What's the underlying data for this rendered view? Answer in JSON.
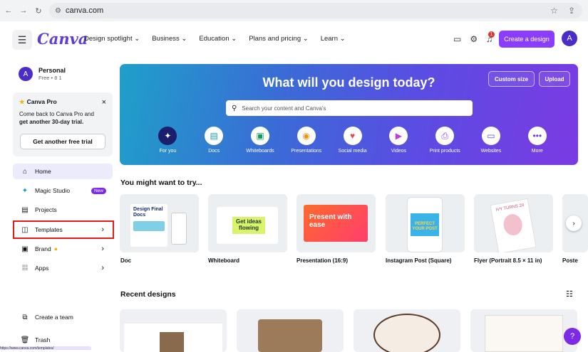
{
  "browser": {
    "url": "canva.com"
  },
  "nav": {
    "logo": "Canva",
    "menu": [
      "Design spotlight ⌄",
      "Business ⌄",
      "Education ⌄",
      "Plans and pricing ⌄",
      "Learn ⌄"
    ],
    "notif_count": "1",
    "create_label": "Create a design",
    "avatar_letter": "A"
  },
  "sidebar": {
    "account_name": "Personal",
    "account_sub": "Free • 8 1",
    "avatar_letter": "A",
    "promo_title": "Canva Pro",
    "promo_body_1": "Come back to Canva Pro and",
    "promo_body_2": "get another 30-day trial.",
    "promo_button": "Get another free trial",
    "items": [
      {
        "label": "Home",
        "icon": "home-icon"
      },
      {
        "label": "Magic Studio",
        "icon": "sparkle-icon",
        "badge": "New"
      },
      {
        "label": "Projects",
        "icon": "folder-icon"
      },
      {
        "label": "Templates",
        "icon": "templates-icon"
      },
      {
        "label": "Brand",
        "icon": "brand-icon"
      },
      {
        "label": "Apps",
        "icon": "apps-icon"
      }
    ],
    "create_team": "Create a team",
    "trash": "Trash",
    "status_url": "https://www.canva.com/templates/"
  },
  "hero": {
    "title": "What will you design today?",
    "custom_size": "Custom size",
    "upload": "Upload",
    "search_placeholder": "Search your content and Canva's",
    "categories": [
      "For you",
      "Docs",
      "Whiteboards",
      "Presentations",
      "Social media",
      "Videos",
      "Print products",
      "Websites",
      "More"
    ]
  },
  "suggest": {
    "title": "You might want to try...",
    "cards": [
      "Doc",
      "Whiteboard",
      "Presentation (16:9)",
      "Instagram Post (Square)",
      "Flyer (Portrait 8.5 × 11 in)",
      "Poste"
    ],
    "thumb_text": {
      "doc": "Design Final Docs",
      "whiteboard": "Get ideas flowing",
      "presentation": "Present with ease",
      "instagram": "PERFECT YOUR POST",
      "flyer": "IVY TURNS 20"
    }
  },
  "recent": {
    "title": "Recent designs"
  },
  "help_label": "?",
  "colors": {
    "accent": "#8b3dff",
    "highlight": "#e21b1b"
  }
}
